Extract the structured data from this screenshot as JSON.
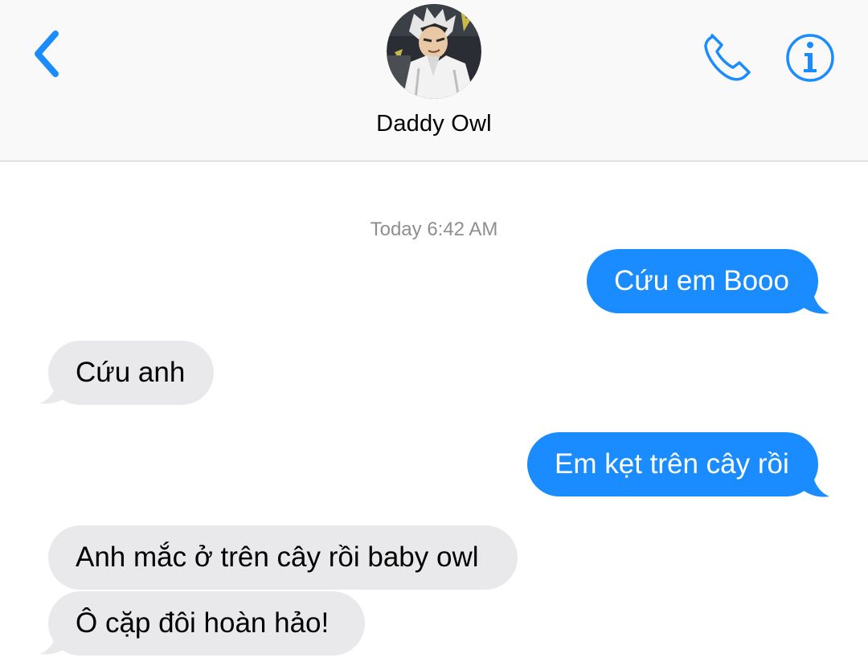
{
  "header": {
    "contact_name": "Daddy Owl",
    "back_icon": "chevron-left-icon",
    "call_icon": "phone-icon",
    "info_icon": "info-icon",
    "accent_color": "#1a8cff"
  },
  "conversation": {
    "timestamp": "Today 6:42 AM",
    "messages": [
      {
        "direction": "sent",
        "text": "Cứu em Booo"
      },
      {
        "direction": "received",
        "text": "Cứu anh"
      },
      {
        "direction": "sent",
        "text": "Em kẹt trên cây rồi"
      },
      {
        "direction": "received",
        "text": "Anh mắc ở trên cây rồi baby owl"
      },
      {
        "direction": "received",
        "text": "Ô cặp đôi hoàn hảo!"
      }
    ]
  },
  "colors": {
    "sent_bubble": "#1a8cff",
    "received_bubble": "#e9e9eb",
    "timestamp_text": "#8e8e93",
    "header_background": "#f9f9f9"
  }
}
